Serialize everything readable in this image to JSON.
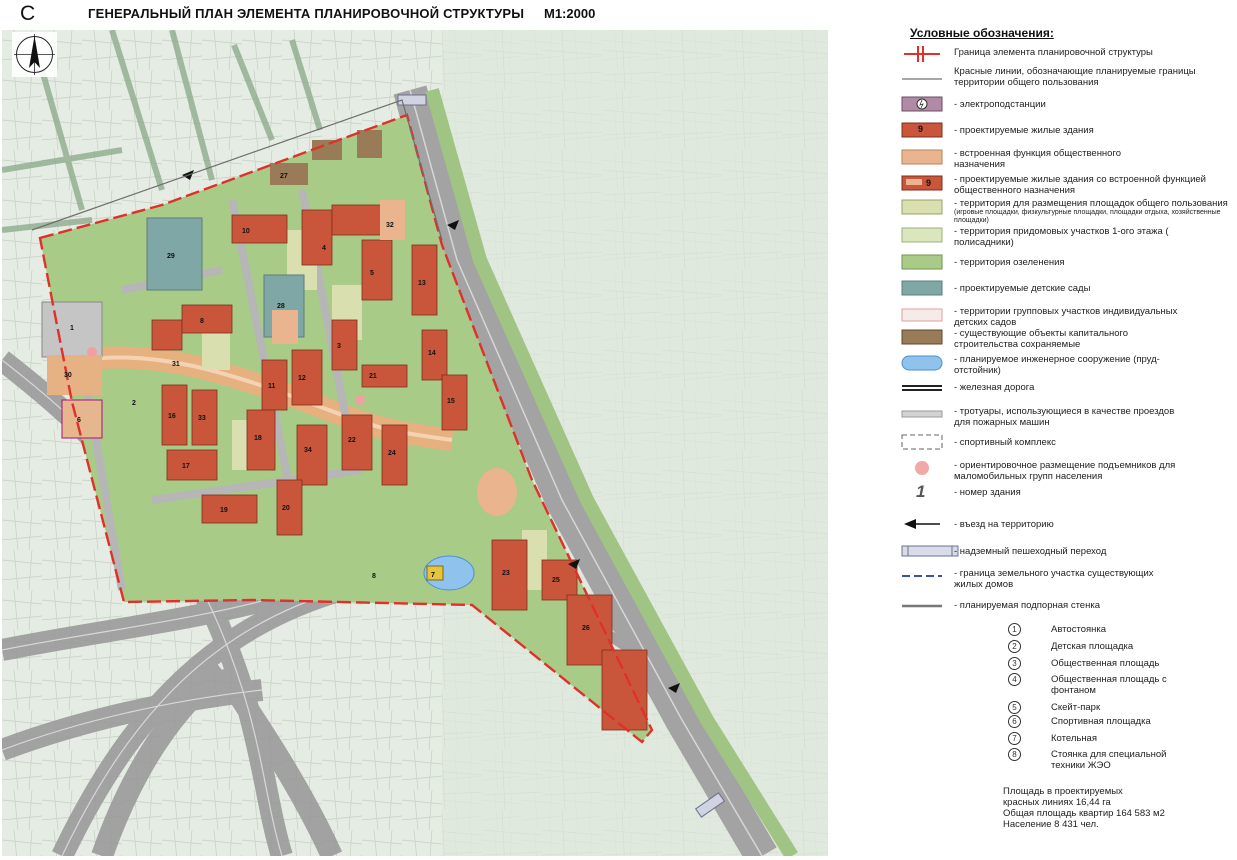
{
  "header": {
    "north_letter": "С",
    "title": "ГЕНЕРАЛЬНЫЙ ПЛАН ЭЛЕМЕНТА ПЛАНИРОВОЧНОЙ СТРУКТУРЫ",
    "scale": "М1:2000"
  },
  "legend": {
    "title": "Условные обозначения:",
    "items": [
      {
        "label": "Граница элемента планировочной структуры",
        "symbol": "boundary-red"
      },
      {
        "label": "Красные линии, обозначающие планируемые границы территории общего пользования",
        "symbol": "gray-line"
      },
      {
        "label": "- электроподстанции",
        "symbol": "substation"
      },
      {
        "label": "- проектируемые жилые здания",
        "symbol": "residential",
        "badge": "9"
      },
      {
        "label": "- встроенная функция общественного назначения",
        "symbol": "public-function"
      },
      {
        "label": "- проектируемые жилые здания со встроенной функцией общественного назначения",
        "symbol": "residential-public",
        "badge": "9"
      },
      {
        "label": "- территория для размещения площадок общего пользования",
        "sublabel": "(игровые площадки, физкультурные площадки, площадки отдыха, хозяйственные площадки)",
        "symbol": "playgrounds"
      },
      {
        "label": "- территория придомовых участков 1-ого этажа ( полисадники)",
        "symbol": "front-gardens"
      },
      {
        "label": "- территория озеленения",
        "symbol": "greenery"
      },
      {
        "label": "- проектируемые детские сады",
        "symbol": "kindergarten"
      },
      {
        "label": "- территории групповых участков индивидуальных детских садов",
        "symbol": "kg-plots"
      },
      {
        "label": "- существующие объекты капитального строительства сохраняемые",
        "symbol": "existing"
      },
      {
        "label": "- планируемое инженерное сооружение (пруд-отстойник)",
        "symbol": "pond"
      },
      {
        "label": "- железная дорога",
        "symbol": "railway"
      },
      {
        "label": "- тротуары, использующиеся в качестве проездов для пожарных машин",
        "symbol": "sidewalk"
      },
      {
        "label": "- спортивный комплекс",
        "symbol": "sports-complex"
      },
      {
        "label": "- ориентировочное размещение подъемников для маломобильных групп населения",
        "symbol": "lift"
      },
      {
        "label": "- номер здания",
        "symbol": "building-number",
        "badge": "1"
      },
      {
        "label": "- въезд на территорию",
        "symbol": "entry-arrow"
      },
      {
        "label": "- надземный пешеходный переход",
        "symbol": "overpass"
      },
      {
        "label": "- граница земельного участка существующих жилых домов",
        "symbol": "blue-dashed"
      },
      {
        "label": "- планируемая подпорная стенка",
        "symbol": "retaining-wall"
      }
    ]
  },
  "numbered_objects": [
    {
      "num": "1",
      "label": "Автостоянка"
    },
    {
      "num": "2",
      "label": "Детская площадка"
    },
    {
      "num": "3",
      "label": "Общественная площадь"
    },
    {
      "num": "4",
      "label": "Общественная площадь с фонтаном"
    },
    {
      "num": "5",
      "label": "Скейт-парк"
    },
    {
      "num": "6",
      "label": "Спортивная площадка"
    },
    {
      "num": "7",
      "label": "Котельная"
    },
    {
      "num": "8",
      "label": "Стоянка для специальной техники ЖЭО"
    }
  ],
  "stats": {
    "area": "Площадь в  проектируемых красных линиях 16,44 га",
    "apartments": "Общая площадь квартир 164 583 м2",
    "population": "Население  8 431 чел."
  },
  "map_labels": {
    "b1": "1",
    "b2": "2",
    "b3": "3",
    "b4": "4",
    "b5": "5",
    "b6": "6",
    "b7": "7",
    "b8": "8",
    "b10": "10",
    "b11": "11",
    "b12": "12",
    "b13": "13",
    "b14": "14",
    "b15": "15",
    "b16": "16",
    "b17": "17",
    "b18": "18",
    "b19": "19",
    "b20": "20",
    "b21": "21",
    "b22": "22",
    "b23": "23",
    "b24": "24",
    "b25": "25",
    "b26": "26",
    "b27": "27",
    "b28": "28",
    "b29": "29",
    "b30": "30",
    "b31": "31",
    "b32": "32",
    "b33": "33",
    "b34": "34"
  },
  "colors": {
    "boundary": "#e0302a",
    "residential": "#c9563a",
    "public": "#e9b48e",
    "greenery": "#a9cb88",
    "playground": "#d9dfae",
    "kindergarten": "#7fa7a6",
    "existing": "#9a7b58",
    "pond": "#8fc3ee",
    "road": "#a8a8a8",
    "background_map": "#e3ebe0"
  }
}
